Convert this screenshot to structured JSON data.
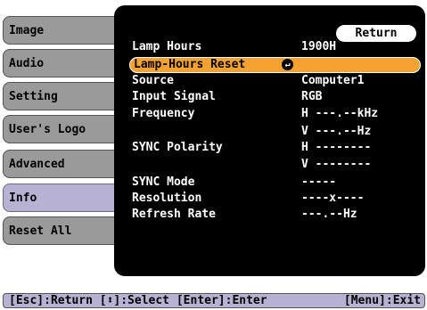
{
  "sidebar": {
    "items": [
      {
        "label": "Image"
      },
      {
        "label": "Audio"
      },
      {
        "label": "Setting"
      },
      {
        "label": "User's Logo"
      },
      {
        "label": "Advanced"
      },
      {
        "label": "Info"
      },
      {
        "label": "Reset All"
      }
    ],
    "active": "Info"
  },
  "panel": {
    "return_label": "Return",
    "rows": [
      {
        "label": "Lamp Hours",
        "value": "1900H"
      },
      {
        "label": "Lamp-Hours Reset",
        "value": ""
      },
      {
        "label": "Source",
        "value": "Computer1"
      },
      {
        "label": "Input Signal",
        "value": "RGB"
      },
      {
        "label": "Frequency",
        "value": "H ---.--kHz"
      },
      {
        "label": "",
        "value": "V ---.--Hz"
      },
      {
        "label": "SYNC Polarity",
        "value": "H --------"
      },
      {
        "label": "",
        "value": "V --------"
      },
      {
        "label": "SYNC Mode",
        "value": "-----"
      },
      {
        "label": "Resolution",
        "value": "----x----"
      },
      {
        "label": "Refresh Rate",
        "value": "---.--Hz"
      }
    ],
    "selected_row": "Lamp-Hours Reset",
    "enter_icon": "enter-icon"
  },
  "footer": {
    "left": "[Esc]:Return [⬍]:Select [Enter]:Enter",
    "right": "[Menu]:Exit"
  },
  "colors": {
    "tab": "#9a9a9a",
    "tab_active": "#b7b2d3",
    "highlight": "#f5a233",
    "panel": "#000000"
  }
}
